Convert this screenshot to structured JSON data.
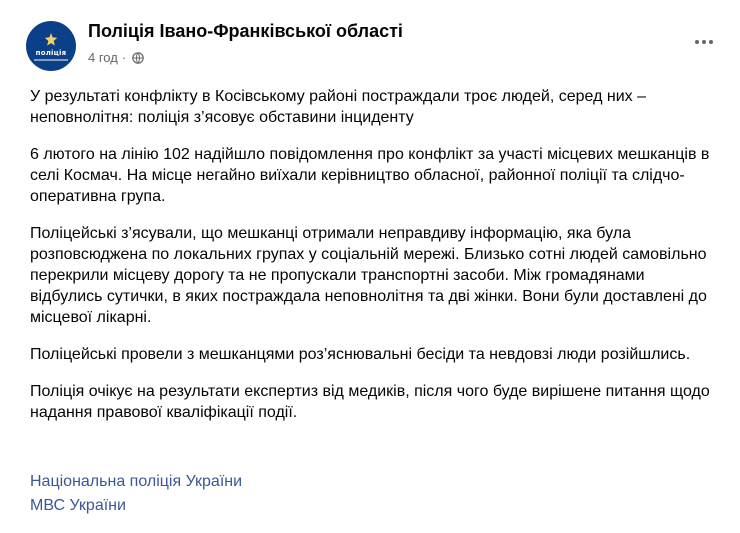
{
  "post": {
    "page_name": "Поліція Івано-Франківської області",
    "time": "4 год",
    "separator": "·",
    "avatar": {
      "label": "поліція"
    },
    "paragraphs": [
      "У результаті конфлікту в Косівському районі постраждали троє людей, серед них – неповнолітня: поліція з’ясовує обставини інциденту",
      "6 лютого на лінію 102 надійшло повідомлення про конфлікт за участі місцевих мешканців в селі Космач. На місце негайно виїхали керівництво обласної, районної поліції та слідчо-оперативна група.",
      "Поліцейські з’ясували, що мешканці отримали неправдиву інформацію, яка була розповсюджена по локальних групах у соціальній мережі. Близько сотні людей самовільно перекрили місцеву дорогу та не пропускали транспортні засоби. Між громадянами відбулись сутички, в яких постраждала неповнолітня та дві жінки. Вони були доставлені до місцевої лікарні.",
      "Поліцейські провели з мешканцями роз’яснювальні бесіди та невдовзі люди розійшлись.",
      "Поліція очікує на результати експертиз від медиків, після чого буде вирішене питання щодо надання правової кваліфікації події."
    ],
    "links": [
      "Національна поліція України",
      "МВС України"
    ],
    "icons": {
      "privacy": "globe-icon",
      "menu": "more-options-icon"
    },
    "colors": {
      "link": "#385898",
      "meta": "#65676b",
      "avatar_bg": "#0b3f87"
    }
  }
}
